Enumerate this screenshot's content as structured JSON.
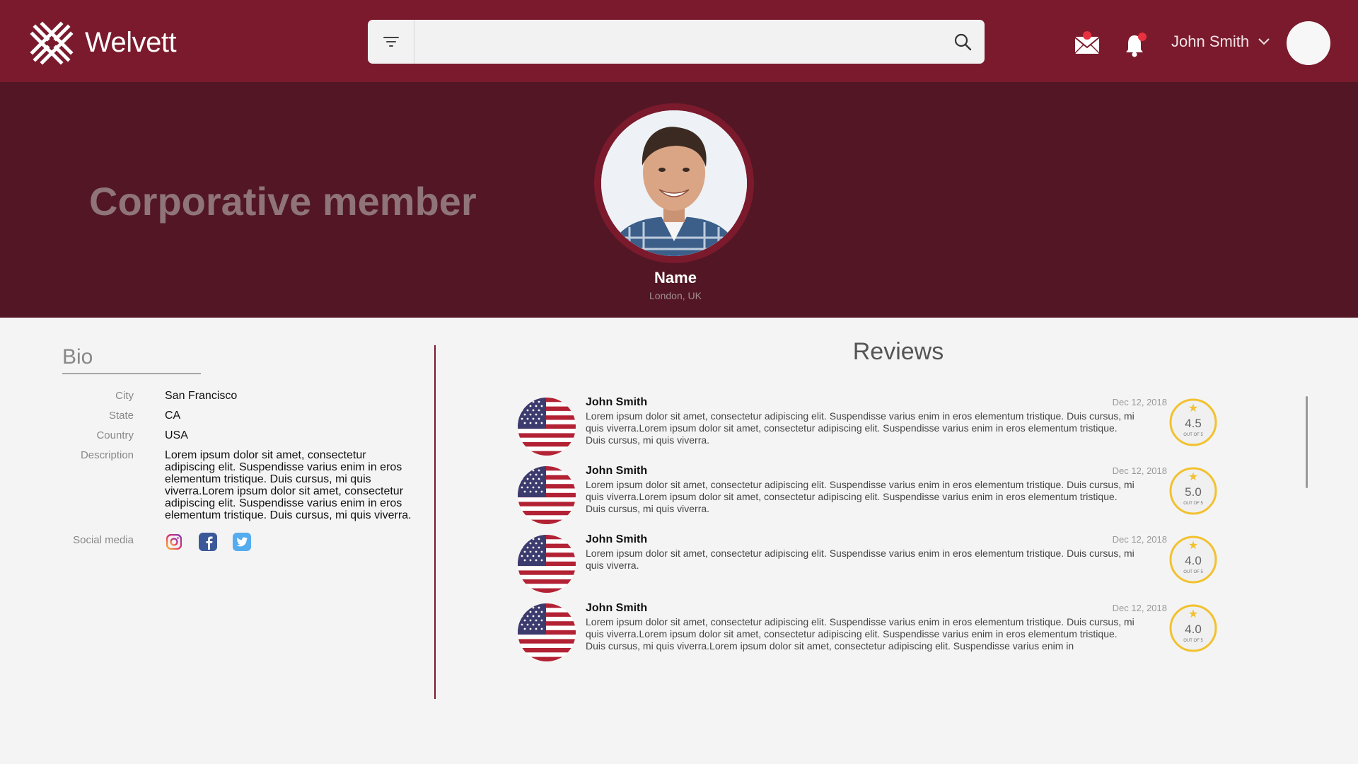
{
  "header": {
    "logo_text": "Welvett",
    "search": {
      "placeholder": "",
      "value": ""
    },
    "user_name": "John Smith"
  },
  "hero": {
    "title": "Corporative member",
    "profile_name": "Name",
    "profile_location": "London, UK"
  },
  "bio": {
    "title": "Bio",
    "fields": [
      {
        "label": "City",
        "value": "San Francisco"
      },
      {
        "label": "State",
        "value": "CA"
      },
      {
        "label": "Country",
        "value": "USA"
      },
      {
        "label": "Description",
        "value": "Lorem ipsum dolor sit amet, consectetur adipiscing elit. Suspendisse varius enim in eros elementum tristique. Duis cursus, mi quis viverra.Lorem ipsum dolor sit amet, consectetur adipiscing elit. Suspendisse varius enim in eros elementum tristique. Duis cursus, mi quis viverra."
      }
    ],
    "social_label": "Social media",
    "social": [
      "instagram-icon",
      "facebook-icon",
      "twitter-icon"
    ]
  },
  "reviews": {
    "title": "Reviews",
    "items": [
      {
        "name": "John Smith",
        "date": "Dec 12, 2018",
        "text": "Lorem ipsum dolor sit amet, consectetur adipiscing elit. Suspendisse varius enim in eros elementum tristique. Duis cursus, mi quis viverra.Lorem ipsum dolor sit amet, consectetur adipiscing elit. Suspendisse varius enim in eros elementum tristique. Duis cursus, mi quis viverra.",
        "rating": "4.5",
        "out_of": "OUT OF 5"
      },
      {
        "name": "John Smith",
        "date": "Dec 12, 2018",
        "text": "Lorem ipsum dolor sit amet, consectetur adipiscing elit. Suspendisse varius enim in eros elementum tristique. Duis cursus, mi quis viverra.Lorem ipsum dolor sit amet, consectetur adipiscing elit. Suspendisse varius enim in eros elementum tristique. Duis cursus, mi quis viverra.",
        "rating": "5.0",
        "out_of": "OUT OF 5"
      },
      {
        "name": "John Smith",
        "date": "Dec 12, 2018",
        "text": "Lorem ipsum dolor sit amet, consectetur adipiscing elit. Suspendisse varius enim in eros elementum tristique. Duis cursus, mi quis viverra.",
        "rating": "4.0",
        "out_of": "OUT OF 5"
      },
      {
        "name": "John Smith",
        "date": "Dec 12, 2018",
        "text": "Lorem ipsum dolor sit amet, consectetur adipiscing elit. Suspendisse varius enim in eros elementum tristique. Duis cursus, mi quis viverra.Lorem ipsum dolor sit amet, consectetur adipiscing elit. Suspendisse varius enim in eros elementum tristique. Duis cursus, mi quis viverra.Lorem ipsum dolor sit amet, consectetur adipiscing elit. Suspendisse varius enim in",
        "rating": "4.0",
        "out_of": "OUT OF 5"
      }
    ]
  },
  "colors": {
    "topbar": "#7a1a2c",
    "hero": "#521624",
    "accent_star": "#f2c12e",
    "notification_dot": "#e8313f"
  }
}
